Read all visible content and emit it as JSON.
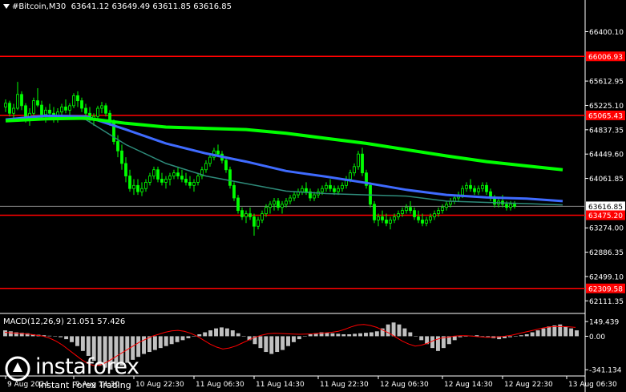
{
  "header": {
    "symbol": "#Bitcoin,M30",
    "ohlc": "63641.12 63649.49 63611.85 63616.85"
  },
  "macd": {
    "label": "MACD(12,26,9) 21.051 57.426",
    "ticks": [
      {
        "v": 149.439,
        "label": "149.439"
      },
      {
        "v": 0,
        "label": "0.00"
      },
      {
        "v": -341.134,
        "label": "-341.134"
      }
    ],
    "range": [
      -380,
      175
    ]
  },
  "logo": {
    "name": "instaforex",
    "tagline": "Instant Forex Trading"
  },
  "colors": {
    "bg": "#000000",
    "bull": "#00ff00",
    "bear": "#00ff00",
    "ma_slow": "#00ff00",
    "ma_mid": "#3f6bff",
    "ma_fast": "#2e8b7a",
    "hline": "#ff0000",
    "hist": "#c0c0c0",
    "signal": "#ff0000"
  },
  "chart_data": {
    "type": "candlestick",
    "symbol": "#Bitcoin",
    "timeframe": "M30",
    "ylim": [
      62000,
      66700
    ],
    "y_ticks": [
      66400.1,
      65612.95,
      65225.1,
      64837.35,
      64449.6,
      64061.85,
      63274.0,
      62886.35,
      62499.1,
      62111.35
    ],
    "price_labels": [
      {
        "value": 66006.93,
        "label": "66006.93",
        "style": "red"
      },
      {
        "value": 65065.43,
        "label": "65065.43",
        "style": "red"
      },
      {
        "value": 63616.85,
        "label": "63616.85",
        "style": "current"
      },
      {
        "value": 63475.2,
        "label": "63475.20",
        "style": "red"
      },
      {
        "value": 62309.58,
        "label": "62309.58",
        "style": "red"
      }
    ],
    "x_labels": [
      {
        "bar": 0,
        "label": "9 Aug 2024"
      },
      {
        "bar": 17,
        "label": "9 Aug 14:30"
      },
      {
        "bar": 32,
        "label": "10 Aug 22:30"
      },
      {
        "bar": 47,
        "label": "11 Aug 06:30"
      },
      {
        "bar": 62,
        "label": "11 Aug 14:30"
      },
      {
        "bar": 78,
        "label": "11 Aug 22:30"
      },
      {
        "bar": 93,
        "label": "12 Aug 06:30"
      },
      {
        "bar": 109,
        "label": "12 Aug 14:30"
      },
      {
        "bar": 124,
        "label": "12 Aug 22:30"
      },
      {
        "bar": 140,
        "label": "13 Aug 06:30"
      }
    ],
    "candles": [
      [
        65200,
        65320,
        65120,
        65260
      ],
      [
        65260,
        65300,
        65050,
        65100
      ],
      [
        65100,
        65250,
        65000,
        65180
      ],
      [
        65180,
        65600,
        65150,
        65400
      ],
      [
        65400,
        65450,
        65150,
        65220
      ],
      [
        65220,
        65260,
        64950,
        65000
      ],
      [
        65000,
        65180,
        64900,
        65100
      ],
      [
        65100,
        65350,
        65050,
        65300
      ],
      [
        65300,
        65500,
        65200,
        65230
      ],
      [
        65230,
        65300,
        65000,
        65080
      ],
      [
        65080,
        65200,
        64950,
        65150
      ],
      [
        65150,
        65250,
        65050,
        65100
      ],
      [
        65100,
        65200,
        64950,
        65050
      ],
      [
        65050,
        65180,
        64950,
        65120
      ],
      [
        65120,
        65250,
        65050,
        65200
      ],
      [
        65200,
        65320,
        65100,
        65150
      ],
      [
        65150,
        65260,
        65050,
        65220
      ],
      [
        65220,
        65420,
        65180,
        65380
      ],
      [
        65380,
        65450,
        65200,
        65300
      ],
      [
        65300,
        65350,
        65120,
        65180
      ],
      [
        65180,
        65250,
        65050,
        65100
      ],
      [
        65100,
        65200,
        64950,
        65000
      ],
      [
        65000,
        65100,
        64900,
        65050
      ],
      [
        65050,
        65220,
        65000,
        65180
      ],
      [
        65180,
        65280,
        65100,
        65220
      ],
      [
        65220,
        65260,
        65050,
        65100
      ],
      [
        65100,
        65150,
        64900,
        64950
      ],
      [
        64950,
        65000,
        64600,
        64650
      ],
      [
        64650,
        64750,
        64400,
        64500
      ],
      [
        64500,
        64600,
        64200,
        64300
      ],
      [
        64300,
        64400,
        64000,
        64100
      ],
      [
        64100,
        64200,
        63850,
        63900
      ],
      [
        63900,
        64050,
        63800,
        63950
      ],
      [
        63950,
        64050,
        63800,
        63850
      ],
      [
        63850,
        64000,
        63780,
        63900
      ],
      [
        63900,
        64050,
        63850,
        64000
      ],
      [
        64000,
        64150,
        63950,
        64100
      ],
      [
        64100,
        64250,
        64050,
        64200
      ],
      [
        64200,
        64250,
        64000,
        64050
      ],
      [
        64050,
        64150,
        63950,
        64000
      ],
      [
        64000,
        64100,
        63900,
        64050
      ],
      [
        64050,
        64150,
        63950,
        64100
      ],
      [
        64100,
        64200,
        64050,
        64150
      ],
      [
        64150,
        64250,
        64050,
        64100
      ],
      [
        64100,
        64200,
        64000,
        64050
      ],
      [
        64050,
        64150,
        63950,
        64000
      ],
      [
        64000,
        64100,
        63900,
        63950
      ],
      [
        63950,
        64050,
        63850,
        64000
      ],
      [
        64000,
        64150,
        63950,
        64100
      ],
      [
        64100,
        64250,
        64050,
        64200
      ],
      [
        64200,
        64350,
        64150,
        64300
      ],
      [
        64300,
        64450,
        64250,
        64400
      ],
      [
        64400,
        64550,
        64350,
        64500
      ],
      [
        64500,
        64600,
        64400,
        64450
      ],
      [
        64450,
        64500,
        64300,
        64350
      ],
      [
        64350,
        64400,
        64150,
        64200
      ],
      [
        64200,
        64250,
        63900,
        63950
      ],
      [
        63950,
        64000,
        63700,
        63750
      ],
      [
        63750,
        63800,
        63500,
        63550
      ],
      [
        63550,
        63600,
        63400,
        63450
      ],
      [
        63450,
        63550,
        63350,
        63500
      ],
      [
        63500,
        63600,
        63400,
        63450
      ],
      [
        63450,
        63500,
        63150,
        63300
      ],
      [
        63300,
        63450,
        63250,
        63400
      ],
      [
        63400,
        63550,
        63350,
        63500
      ],
      [
        63500,
        63650,
        63450,
        63600
      ],
      [
        63600,
        63700,
        63500,
        63650
      ],
      [
        63650,
        63750,
        63550,
        63700
      ],
      [
        63700,
        63750,
        63550,
        63600
      ],
      [
        63600,
        63700,
        63500,
        63650
      ],
      [
        63650,
        63750,
        63600,
        63700
      ],
      [
        63700,
        63800,
        63650,
        63750
      ],
      [
        63750,
        63850,
        63700,
        63800
      ],
      [
        63800,
        63900,
        63750,
        63850
      ],
      [
        63850,
        63950,
        63800,
        63900
      ],
      [
        63900,
        64000,
        63800,
        63850
      ],
      [
        63850,
        63900,
        63700,
        63750
      ],
      [
        63750,
        63850,
        63700,
        63800
      ],
      [
        63800,
        63900,
        63750,
        63850
      ],
      [
        63850,
        63950,
        63800,
        63900
      ],
      [
        63900,
        64000,
        63850,
        63950
      ],
      [
        63950,
        64050,
        63850,
        63900
      ],
      [
        63900,
        63950,
        63800,
        63850
      ],
      [
        63850,
        63950,
        63800,
        63900
      ],
      [
        63900,
        64000,
        63850,
        63950
      ],
      [
        63950,
        64100,
        63900,
        64050
      ],
      [
        64050,
        64200,
        64000,
        64150
      ],
      [
        64150,
        64300,
        64100,
        64250
      ],
      [
        64250,
        64500,
        64200,
        64450
      ],
      [
        64450,
        64550,
        64100,
        64150
      ],
      [
        64150,
        64200,
        63900,
        63950
      ],
      [
        63950,
        64000,
        63600,
        63650
      ],
      [
        63650,
        63700,
        63350,
        63400
      ],
      [
        63400,
        63500,
        63300,
        63450
      ],
      [
        63450,
        63550,
        63350,
        63400
      ],
      [
        63400,
        63500,
        63300,
        63350
      ],
      [
        63350,
        63450,
        63250,
        63400
      ],
      [
        63400,
        63500,
        63350,
        63450
      ],
      [
        63450,
        63550,
        63400,
        63500
      ],
      [
        63500,
        63600,
        63450,
        63550
      ],
      [
        63550,
        63650,
        63500,
        63600
      ],
      [
        63600,
        63700,
        63500,
        63550
      ],
      [
        63550,
        63600,
        63400,
        63450
      ],
      [
        63450,
        63550,
        63350,
        63400
      ],
      [
        63400,
        63500,
        63300,
        63350
      ],
      [
        63350,
        63450,
        63300,
        63400
      ],
      [
        63400,
        63500,
        63350,
        63450
      ],
      [
        63450,
        63550,
        63400,
        63500
      ],
      [
        63500,
        63600,
        63450,
        63550
      ],
      [
        63550,
        63650,
        63500,
        63600
      ],
      [
        63600,
        63700,
        63550,
        63650
      ],
      [
        63650,
        63750,
        63600,
        63700
      ],
      [
        63700,
        63800,
        63650,
        63750
      ],
      [
        63750,
        63850,
        63700,
        63800
      ],
      [
        63800,
        63950,
        63750,
        63900
      ],
      [
        63900,
        64000,
        63850,
        63950
      ],
      [
        63950,
        64050,
        63850,
        63900
      ],
      [
        63900,
        63950,
        63800,
        63850
      ],
      [
        63850,
        63950,
        63800,
        63900
      ],
      [
        63900,
        64000,
        63850,
        63950
      ],
      [
        63950,
        64000,
        63800,
        63850
      ],
      [
        63850,
        63900,
        63700,
        63750
      ],
      [
        63750,
        63800,
        63600,
        63650
      ],
      [
        63650,
        63750,
        63600,
        63700
      ],
      [
        63700,
        63800,
        63600,
        63650
      ],
      [
        63650,
        63700,
        63550,
        63600
      ],
      [
        63600,
        63700,
        63550,
        63650
      ],
      [
        63650,
        63700,
        63580,
        63617
      ]
    ],
    "ma_slow": [
      [
        0,
        64980
      ],
      [
        10,
        65010
      ],
      [
        20,
        65020
      ],
      [
        30,
        64940
      ],
      [
        40,
        64880
      ],
      [
        50,
        64860
      ],
      [
        60,
        64840
      ],
      [
        70,
        64780
      ],
      [
        80,
        64700
      ],
      [
        90,
        64620
      ],
      [
        100,
        64520
      ],
      [
        110,
        64420
      ],
      [
        120,
        64330
      ],
      [
        130,
        64260
      ],
      [
        139,
        64200
      ]
    ],
    "ma_mid": [
      [
        0,
        65000
      ],
      [
        10,
        65060
      ],
      [
        20,
        65050
      ],
      [
        30,
        64840
      ],
      [
        40,
        64620
      ],
      [
        50,
        64460
      ],
      [
        60,
        64330
      ],
      [
        70,
        64180
      ],
      [
        80,
        64090
      ],
      [
        90,
        63990
      ],
      [
        100,
        63880
      ],
      [
        110,
        63800
      ],
      [
        120,
        63760
      ],
      [
        130,
        63740
      ],
      [
        139,
        63700
      ]
    ],
    "ma_fast": [
      [
        0,
        65000
      ],
      [
        10,
        65050
      ],
      [
        20,
        65000
      ],
      [
        30,
        64600
      ],
      [
        40,
        64300
      ],
      [
        50,
        64100
      ],
      [
        60,
        63980
      ],
      [
        70,
        63860
      ],
      [
        80,
        63820
      ],
      [
        90,
        63800
      ],
      [
        100,
        63780
      ],
      [
        110,
        63700
      ],
      [
        120,
        63680
      ],
      [
        130,
        63660
      ],
      [
        139,
        63640
      ]
    ],
    "macd_hist": [
      60,
      50,
      40,
      35,
      30,
      20,
      15,
      10,
      5,
      0,
      -10,
      -30,
      -60,
      -100,
      -150,
      -200,
      -250,
      -300,
      -320,
      -340,
      -320,
      -300,
      -270,
      -240,
      -210,
      -180,
      -160,
      -140,
      -120,
      -100,
      -80,
      -60,
      -40,
      -20,
      0,
      20,
      40,
      60,
      80,
      90,
      80,
      60,
      30,
      0,
      -40,
      -80,
      -120,
      -160,
      -180,
      -160,
      -140,
      -100,
      -60,
      -30,
      0,
      20,
      30,
      40,
      35,
      30,
      25,
      20,
      20,
      25,
      30,
      35,
      40,
      50,
      80,
      120,
      140,
      120,
      80,
      40,
      0,
      -40,
      -80,
      -120,
      -150,
      -120,
      -80,
      -40,
      -10,
      0,
      5,
      10,
      0,
      -10,
      -20,
      -30,
      -20,
      -10,
      0,
      10,
      20,
      40,
      60,
      80,
      100,
      110,
      120,
      100,
      80,
      60
    ],
    "macd_signal": [
      40,
      35,
      30,
      25,
      20,
      10,
      0,
      -20,
      -50,
      -90,
      -140,
      -190,
      -240,
      -280,
      -300,
      -290,
      -260,
      -220,
      -180,
      -140,
      -100,
      -60,
      -30,
      0,
      20,
      40,
      55,
      60,
      50,
      30,
      0,
      -40,
      -80,
      -110,
      -130,
      -120,
      -100,
      -70,
      -40,
      -10,
      10,
      25,
      30,
      28,
      25,
      22,
      20,
      22,
      25,
      30,
      35,
      40,
      50,
      70,
      95,
      115,
      120,
      110,
      90,
      60,
      30,
      -10,
      -50,
      -80,
      -100,
      -90,
      -70,
      -40,
      -20,
      -10,
      0,
      5,
      5,
      0,
      -5,
      -10,
      -10,
      -5,
      0,
      10,
      25,
      40,
      55,
      70,
      85,
      95,
      100,
      98,
      95,
      90
    ]
  }
}
